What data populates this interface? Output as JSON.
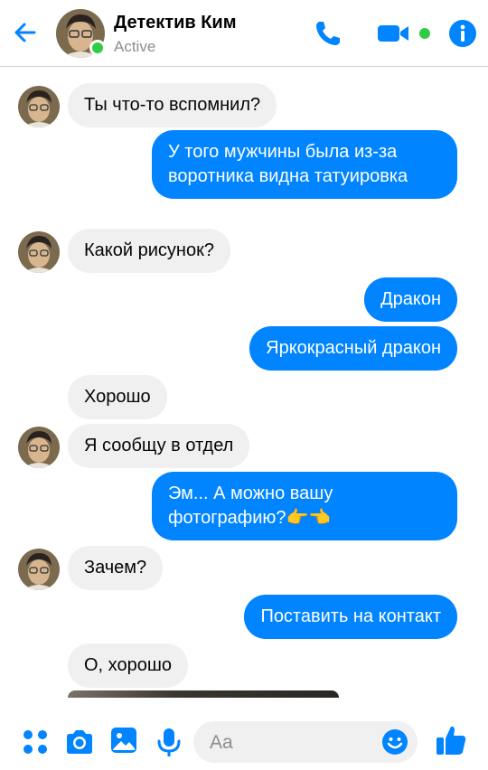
{
  "header": {
    "name": "Детектив Ким",
    "status": "Active",
    "accent": "#0084ff",
    "online_color": "#31cc46"
  },
  "messages": [
    {
      "dir": "in",
      "text": "Ты что-то вспомнил?"
    },
    {
      "dir": "out",
      "text": "У того мужчины была из-за воротника видна татуировка"
    },
    {
      "dir": "in",
      "text": "Какой рисунок?"
    },
    {
      "dir": "out",
      "text": "Дракон"
    },
    {
      "dir": "out",
      "text": "Яркокрасный дракон"
    },
    {
      "dir": "in",
      "text": "Хорошо"
    },
    {
      "dir": "in",
      "text": "Я сообщу в отдел"
    },
    {
      "dir": "out",
      "text": "Эм... А можно вашу фотографию?👉👈"
    },
    {
      "dir": "in",
      "text": "Зачем?"
    },
    {
      "dir": "out",
      "text": "Поставить на контакт"
    },
    {
      "dir": "in",
      "text": "О, хорошо"
    }
  ],
  "composer": {
    "placeholder": "Aa",
    "icons": [
      "apps-icon",
      "camera-icon",
      "gallery-icon",
      "mic-icon",
      "emoji-icon",
      "thumbs-up-icon"
    ]
  }
}
